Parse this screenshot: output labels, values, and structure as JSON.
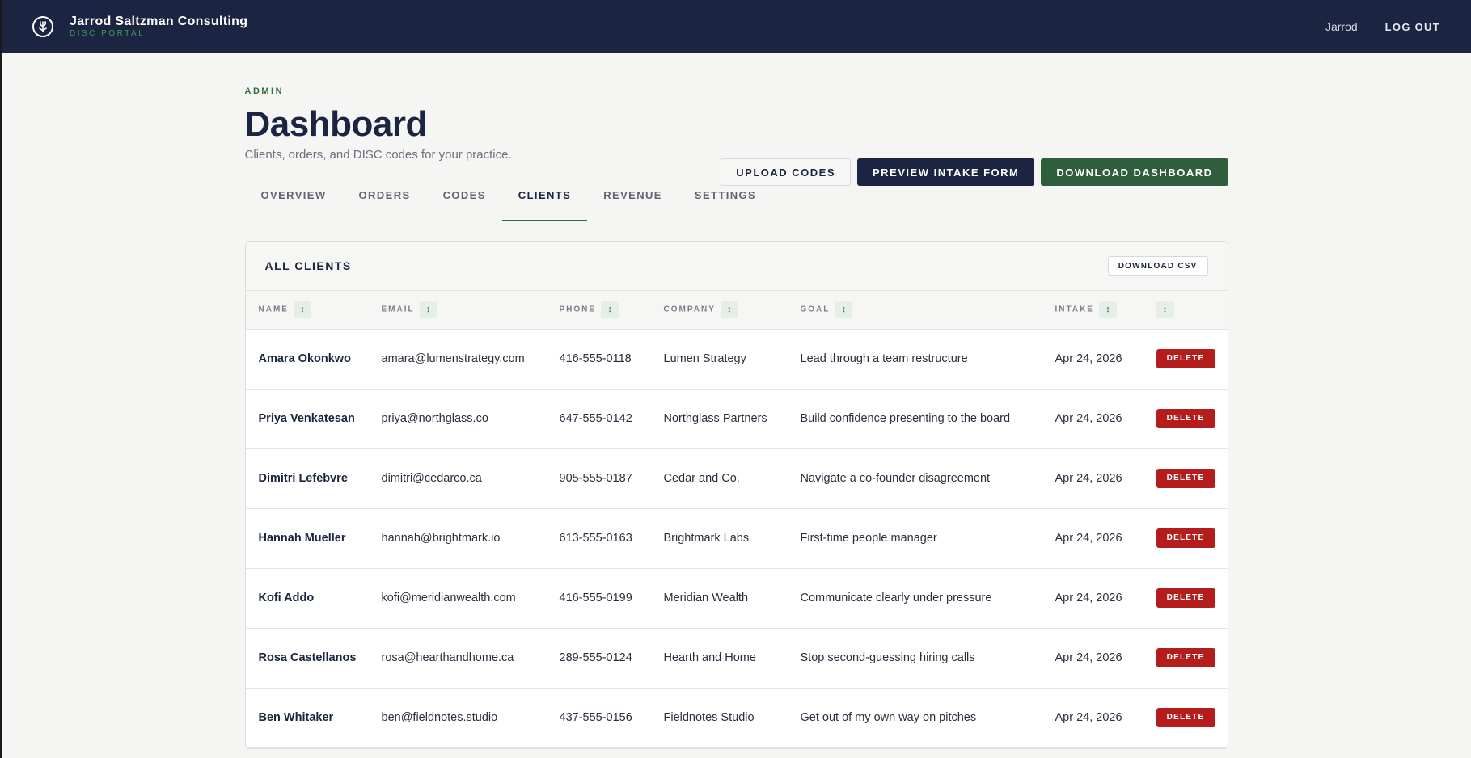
{
  "header": {
    "brand_name": "Jarrod Saltzman Consulting",
    "brand_sub": "DISC PORTAL",
    "user": "Jarrod",
    "logout": "LOG OUT"
  },
  "page": {
    "eyebrow": "ADMIN",
    "title": "Dashboard",
    "subtitle": "Clients, orders, and DISC codes for your practice.",
    "actions": {
      "upload": "UPLOAD CODES",
      "preview": "PREVIEW INTAKE FORM",
      "download": "DOWNLOAD DASHBOARD"
    }
  },
  "tabs": [
    {
      "label": "OVERVIEW"
    },
    {
      "label": "ORDERS"
    },
    {
      "label": "CODES"
    },
    {
      "label": "CLIENTS"
    },
    {
      "label": "REVENUE"
    },
    {
      "label": "SETTINGS"
    }
  ],
  "active_tab": "CLIENTS",
  "clients": {
    "title": "ALL CLIENTS",
    "csv_label": "DOWNLOAD CSV",
    "sort_icon": "↕",
    "columns": [
      "NAME",
      "EMAIL",
      "PHONE",
      "COMPANY",
      "GOAL",
      "INTAKE",
      ""
    ],
    "delete_label": "DELETE",
    "rows": [
      {
        "name": "Amara Okonkwo",
        "email": "amara@lumenstrategy.com",
        "phone": "416-555-0118",
        "company": "Lumen Strategy",
        "goal": "Lead through a team restructure",
        "intake": "Apr 24, 2026"
      },
      {
        "name": "Priya Venkatesan",
        "email": "priya@northglass.co",
        "phone": "647-555-0142",
        "company": "Northglass Partners",
        "goal": "Build confidence presenting to the board",
        "intake": "Apr 24, 2026"
      },
      {
        "name": "Dimitri Lefebvre",
        "email": "dimitri@cedarco.ca",
        "phone": "905-555-0187",
        "company": "Cedar and Co.",
        "goal": "Navigate a co-founder disagreement",
        "intake": "Apr 24, 2026"
      },
      {
        "name": "Hannah Mueller",
        "email": "hannah@brightmark.io",
        "phone": "613-555-0163",
        "company": "Brightmark Labs",
        "goal": "First-time people manager",
        "intake": "Apr 24, 2026"
      },
      {
        "name": "Kofi Addo",
        "email": "kofi@meridianwealth.com",
        "phone": "416-555-0199",
        "company": "Meridian Wealth",
        "goal": "Communicate clearly under pressure",
        "intake": "Apr 24, 2026"
      },
      {
        "name": "Rosa Castellanos",
        "email": "rosa@hearthandhome.ca",
        "phone": "289-555-0124",
        "company": "Hearth and Home",
        "goal": "Stop second-guessing hiring calls",
        "intake": "Apr 24, 2026"
      },
      {
        "name": "Ben Whitaker",
        "email": "ben@fieldnotes.studio",
        "phone": "437-555-0156",
        "company": "Fieldnotes Studio",
        "goal": "Get out of my own way on pitches",
        "intake": "Apr 24, 2026"
      }
    ]
  },
  "colors": {
    "navy": "#1b2440",
    "green": "#2f5e3c",
    "accent_green": "#3e9b58",
    "danger": "#b51c1c"
  }
}
